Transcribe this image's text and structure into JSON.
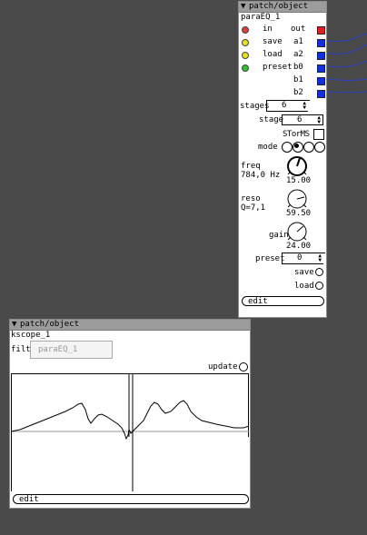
{
  "eq": {
    "header": "patch/object",
    "name": "paraEQ_1",
    "inlets": [
      {
        "label": "in",
        "color": "#e03c3c"
      },
      {
        "label": "save",
        "color": "#e8e020"
      },
      {
        "label": "load",
        "color": "#e8e020"
      },
      {
        "label": "preset",
        "color": "#30c030"
      }
    ],
    "outlets": [
      {
        "label": "out",
        "color": "#e02020"
      },
      {
        "label": "a1",
        "color": "#1030e0"
      },
      {
        "label": "a2",
        "color": "#1030e0"
      },
      {
        "label": "b0",
        "color": "#1030e0"
      },
      {
        "label": "b1",
        "color": "#1030e0"
      },
      {
        "label": "b2",
        "color": "#1030e0"
      }
    ],
    "stages_label": "stages",
    "stages_value": "6",
    "stage_label": "stage",
    "stage_value": "6",
    "stormls_label": "STorMS",
    "mode_label": "mode",
    "mode_selected": 2,
    "freq_label": "freq",
    "freq_readout": "784,0 Hz",
    "freq_value": "15.00",
    "reso_label": "reso",
    "reso_readout": "Q=7,1",
    "reso_value": "59.50",
    "gain_label": "gain",
    "gain_value": "24.00",
    "preset_label": "preset",
    "preset_value": "0",
    "save_label": "save",
    "load_label": "load",
    "edit_label": "edit"
  },
  "scope": {
    "header": "patch/object",
    "name": "kscope_1",
    "filter_label": "filter",
    "filter_placeholder": "paraEQ_1",
    "update_label": "update",
    "edit_label": "edit"
  },
  "colors": {
    "background": "#4a4a4a",
    "header": "#9c9c9c",
    "wire": "#2a40c0"
  }
}
